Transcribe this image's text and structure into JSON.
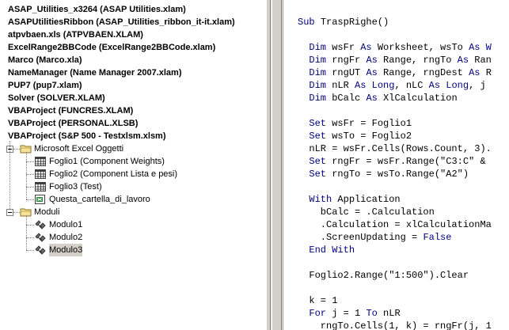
{
  "explorer": {
    "projects": [
      {
        "label": "ASAP_Utilities_x3264 (ASAP Utilities.xlam)"
      },
      {
        "label": "ASAPUtilitiesRibbon (ASAP_Utilities_ribbon_it-it.xlam)"
      },
      {
        "label": "atpvbaen.xls (ATPVBAEN.XLAM)"
      },
      {
        "label": "ExcelRange2BBCode (ExcelRange2BBCode.xlam)"
      },
      {
        "label": "Marco (Marco.xla)"
      },
      {
        "label": "NameManager (Name Manager 2007.xlam)"
      },
      {
        "label": "PUP7 (pup7.xlam)"
      },
      {
        "label": "Solver (SOLVER.XLAM)"
      },
      {
        "label": "VBAProject (FUNCRES.XLAM)"
      },
      {
        "label": "VBAProject (PERSONAL.XLSB)"
      },
      {
        "label": "VBAProject (S&P 500 - Testxlsm.xlsm)"
      }
    ],
    "folders": {
      "excel_objects": {
        "label": "Microsoft Excel Oggetti",
        "items": [
          {
            "label": "Foglio1 (Component Weights)"
          },
          {
            "label": "Foglio2 (Component Lista e pesi)"
          },
          {
            "label": "Foglio3 (Test)"
          },
          {
            "label": "Questa_cartella_di_lavoro"
          }
        ]
      },
      "modules": {
        "label": "Moduli",
        "items": [
          {
            "label": "Modulo1"
          },
          {
            "label": "Modulo2"
          },
          {
            "label": "Modulo3",
            "selected": true
          }
        ]
      }
    }
  },
  "code": {
    "lines": [
      {
        "segments": [
          {
            "t": "Sub ",
            "k": true
          },
          {
            "t": "TraspRighe()"
          }
        ]
      },
      {
        "segments": [
          {
            "t": ""
          }
        ]
      },
      {
        "segments": [
          {
            "t": "  "
          },
          {
            "t": "Dim ",
            "k": true
          },
          {
            "t": "wsFr "
          },
          {
            "t": "As ",
            "k": true
          },
          {
            "t": "Worksheet, wsTo "
          },
          {
            "t": "As W",
            "k": true
          }
        ]
      },
      {
        "segments": [
          {
            "t": "  "
          },
          {
            "t": "Dim ",
            "k": true
          },
          {
            "t": "rngFr "
          },
          {
            "t": "As ",
            "k": true
          },
          {
            "t": "Range, rngTo "
          },
          {
            "t": "As ",
            "k": true
          },
          {
            "t": "Ran"
          }
        ]
      },
      {
        "segments": [
          {
            "t": "  "
          },
          {
            "t": "Dim ",
            "k": true
          },
          {
            "t": "rngUT "
          },
          {
            "t": "As ",
            "k": true
          },
          {
            "t": "Range, rngDest "
          },
          {
            "t": "As ",
            "k": true
          },
          {
            "t": "R"
          }
        ]
      },
      {
        "segments": [
          {
            "t": "  "
          },
          {
            "t": "Dim ",
            "k": true
          },
          {
            "t": "nLR "
          },
          {
            "t": "As Long",
            "k": true
          },
          {
            "t": ", nLC "
          },
          {
            "t": "As Long",
            "k": true
          },
          {
            "t": ", j "
          }
        ]
      },
      {
        "segments": [
          {
            "t": "  "
          },
          {
            "t": "Dim ",
            "k": true
          },
          {
            "t": "bCalc "
          },
          {
            "t": "As ",
            "k": true
          },
          {
            "t": "XlCalculation"
          }
        ]
      },
      {
        "segments": [
          {
            "t": ""
          }
        ]
      },
      {
        "segments": [
          {
            "t": "  "
          },
          {
            "t": "Set ",
            "k": true
          },
          {
            "t": "wsFr = Foglio1"
          }
        ]
      },
      {
        "segments": [
          {
            "t": "  "
          },
          {
            "t": "Set ",
            "k": true
          },
          {
            "t": "wsTo = Foglio2"
          }
        ]
      },
      {
        "segments": [
          {
            "t": "  nLR = wsFr.Cells(Rows.Count, 3)."
          }
        ]
      },
      {
        "segments": [
          {
            "t": "  "
          },
          {
            "t": "Set ",
            "k": true
          },
          {
            "t": "rngFr = wsFr.Range(\"C3:C\" & "
          }
        ]
      },
      {
        "segments": [
          {
            "t": "  "
          },
          {
            "t": "Set ",
            "k": true
          },
          {
            "t": "rngTo = wsTo.Range(\"A2\")"
          }
        ]
      },
      {
        "segments": [
          {
            "t": ""
          }
        ]
      },
      {
        "segments": [
          {
            "t": "  "
          },
          {
            "t": "With ",
            "k": true
          },
          {
            "t": "Application"
          }
        ]
      },
      {
        "segments": [
          {
            "t": "    bCalc = .Calculation"
          }
        ]
      },
      {
        "segments": [
          {
            "t": "    .Calculation = xlCalculationMa"
          }
        ]
      },
      {
        "segments": [
          {
            "t": "    .ScreenUpdating = "
          },
          {
            "t": "False",
            "k": true
          }
        ]
      },
      {
        "segments": [
          {
            "t": "  "
          },
          {
            "t": "End With",
            "k": true
          }
        ]
      },
      {
        "segments": [
          {
            "t": ""
          }
        ]
      },
      {
        "segments": [
          {
            "t": "  Foglio2.Range(\"1:500\").Clear"
          }
        ]
      },
      {
        "segments": [
          {
            "t": ""
          }
        ]
      },
      {
        "segments": [
          {
            "t": "  k = 1"
          }
        ]
      },
      {
        "segments": [
          {
            "t": "  "
          },
          {
            "t": "For ",
            "k": true
          },
          {
            "t": "j = 1 "
          },
          {
            "t": "To ",
            "k": true
          },
          {
            "t": "nLR"
          }
        ]
      },
      {
        "segments": [
          {
            "t": "    rngTo.Cells(1, k) = rngFr(j, 1"
          }
        ]
      }
    ]
  }
}
